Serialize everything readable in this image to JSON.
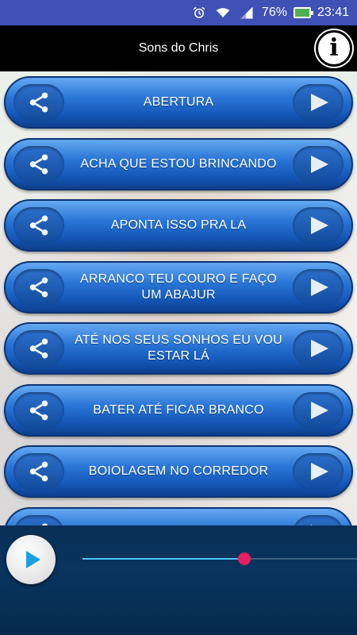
{
  "status_bar": {
    "battery_percent": "76%",
    "time": "23:41",
    "icons": [
      "alarm-icon",
      "wifi-icon",
      "signal-icon",
      "battery-charging-icon"
    ]
  },
  "app_bar": {
    "title": "Sons do Chris",
    "info_icon": "info-icon"
  },
  "sounds": [
    {
      "label": "ABERTURA"
    },
    {
      "label": "ACHA QUE ESTOU BRINCANDO"
    },
    {
      "label": "APONTA ISSO PRA LA"
    },
    {
      "label": "ARRANCO TEU COURO E FAÇO UM ABAJUR"
    },
    {
      "label": "ATÉ NOS SEUS SONHOS EU VOU ESTAR LÁ"
    },
    {
      "label": "BATER ATÉ FICAR BRANCO"
    },
    {
      "label": "BOIOLAGEM NO CORREDOR"
    },
    {
      "label": ""
    }
  ],
  "colors": {
    "button_blue": "#1457b8",
    "status_bar": "#3f51b5",
    "player_bg": "#08345e",
    "seek_thumb": "#e91e63",
    "seek_fill": "#4fc3f7"
  },
  "player": {
    "progress": 0.59
  }
}
